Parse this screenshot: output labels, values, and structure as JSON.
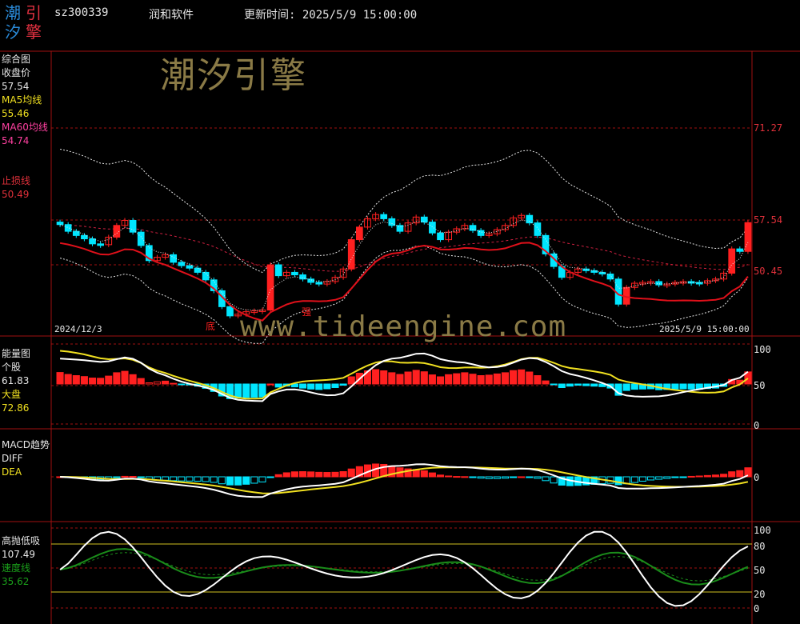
{
  "header": {
    "logo_chars": [
      "潮",
      "引",
      "汐",
      "擎"
    ],
    "code": "sz300339",
    "name": "润和软件",
    "update_label": "更新时间: 2025/5/9 15:00:00"
  },
  "watermark": {
    "brand": "潮汐引擎",
    "url": "www.tideengine.com"
  },
  "panels": {
    "main": {
      "title": "综合图",
      "close_label": "收盘价",
      "close_value": "57.54",
      "ma5_label": "MA5均线",
      "ma5_value": "55.46",
      "ma60_label": "MA60均线",
      "ma60_value": "54.74",
      "stop_label": "止损线",
      "stop_value": "50.49",
      "axis_labels": [
        "71.27",
        "57.54",
        "50.45"
      ],
      "date_start": "2024/12/3",
      "date_end": "2025/5/9 15:00:00",
      "mark_di": "底",
      "mark_qiang": "强"
    },
    "energy": {
      "title": "能量图",
      "stock_label": "个股",
      "stock_value": "61.83",
      "market_label": "大盘",
      "market_value": "72.86",
      "axis_labels": [
        "100",
        "50",
        "0"
      ]
    },
    "macd": {
      "title": "MACD趋势",
      "diff_label": "DIFF",
      "dea_label": "DEA",
      "axis_labels": [
        "0"
      ]
    },
    "osc": {
      "title": "高抛低吸",
      "main_value": "107.49",
      "speed_label": "速度线",
      "speed_value": "35.62",
      "axis_labels": [
        "100",
        "80",
        "50",
        "20",
        "0"
      ]
    }
  },
  "colors": {
    "up": "#ff2020",
    "down": "#00e6ff",
    "ma5": "#f0f0f0",
    "ma_red": "#e0101a",
    "grid": "#a01010",
    "yellow": "#f0e020",
    "green": "#1a8c1a",
    "label_red": "#e0303a"
  },
  "chart_data": {
    "type": "candlestick",
    "closes": [
      57.3,
      56.5,
      56.0,
      55.6,
      55.0,
      54.9,
      55.8,
      57.2,
      57.8,
      56.4,
      54.8,
      53.0,
      53.4,
      53.7,
      52.8,
      52.4,
      52.1,
      51.6,
      50.7,
      49.4,
      47.5,
      46.4,
      46.6,
      46.9,
      47.0,
      47.1,
      52.5,
      51.2,
      51.6,
      51.3,
      50.8,
      50.4,
      50.2,
      50.5,
      51.0,
      52.0,
      55.5,
      57.0,
      58.0,
      58.5,
      58.0,
      57.2,
      56.5,
      57.5,
      58.2,
      57.6,
      56.3,
      55.5,
      56.4,
      56.8,
      57.2,
      56.6,
      56.0,
      56.2,
      56.7,
      57.2,
      58.1,
      58.4,
      57.5,
      56.0,
      53.8,
      52.3,
      51.0,
      51.6,
      52.0,
      51.8,
      51.6,
      51.4,
      50.8,
      47.8,
      49.8,
      50.3,
      50.4,
      50.5,
      50.1,
      50.2,
      50.4,
      50.5,
      50.4,
      50.3,
      50.6,
      50.8,
      51.5,
      54.4,
      54.1,
      57.54
    ],
    "bollinger_upper_last": 63.6,
    "energy": {
      "stock_last": 61.83,
      "market_last": 72.86,
      "ylim": [
        0,
        100
      ]
    },
    "osc": {
      "main_last": 107.49,
      "speed_last": 35.62,
      "levels": [
        100,
        80,
        50,
        20,
        0
      ]
    }
  }
}
